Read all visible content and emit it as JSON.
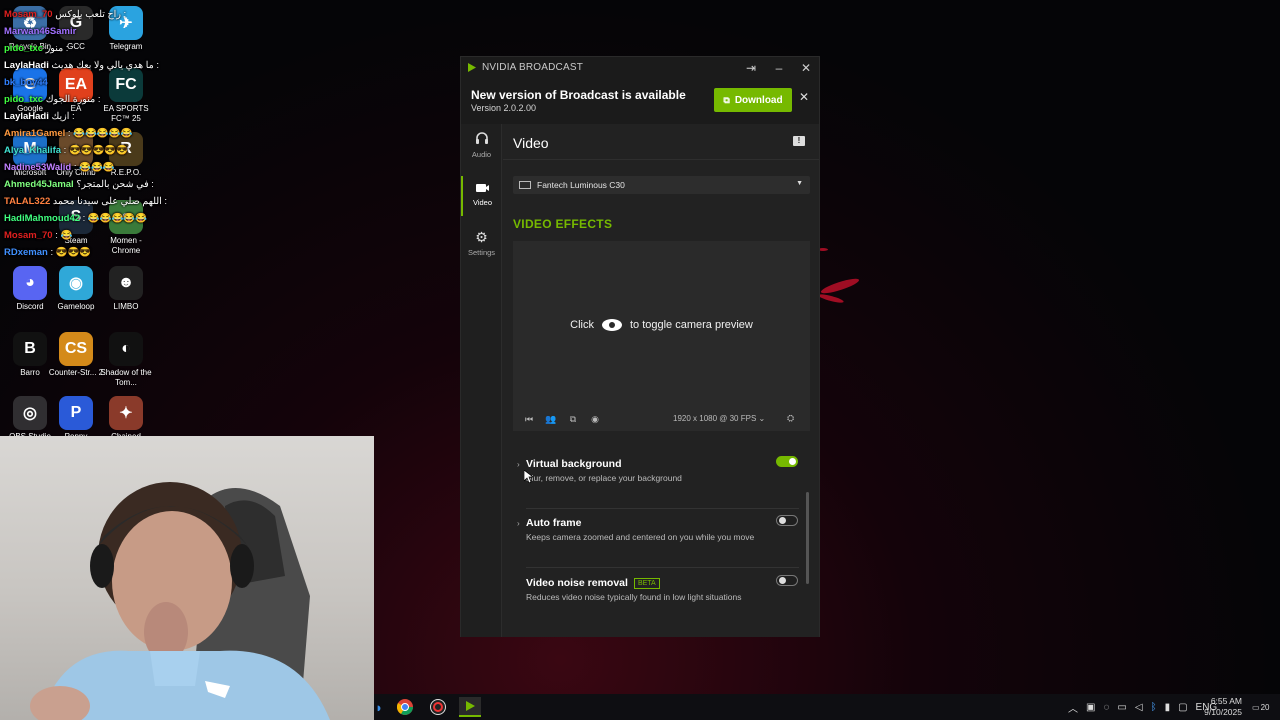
{
  "desktop": {
    "icons": [
      {
        "label": "Recycle Bin",
        "glyph": "♻",
        "color": "#3b6ea5"
      },
      {
        "label": "GCC",
        "glyph": "G",
        "color": "#2a2a2a"
      },
      {
        "label": "Telegram",
        "glyph": "✈",
        "color": "#2aa3e0"
      },
      {
        "label": "Google",
        "glyph": "G",
        "color": "#1a73e8"
      },
      {
        "label": "EA",
        "glyph": "EA",
        "color": "#e0401c"
      },
      {
        "label": "EA SPORTS FC™ 25",
        "glyph": "FC",
        "color": "#0b3a3a"
      },
      {
        "label": "Microsoft",
        "glyph": "M",
        "color": "#1c6fc9"
      },
      {
        "label": "Only Climb",
        "glyph": "▲",
        "color": "#6a4a2a"
      },
      {
        "label": "R.E.P.O.",
        "glyph": "R",
        "color": "#4a3a1a"
      },
      {
        "label": "Steam",
        "glyph": "S",
        "color": "#1b2838"
      },
      {
        "label": "Momen - Chrome",
        "glyph": "●",
        "color": "#3a7a3a"
      },
      {
        "label": "Discord",
        "glyph": "◕",
        "color": "#5865f2"
      },
      {
        "label": "Gameloop",
        "glyph": "◉",
        "color": "#2fa8d8"
      },
      {
        "label": "LIMBO",
        "glyph": "☻",
        "color": "#222222"
      },
      {
        "label": "Barro",
        "glyph": "B",
        "color": "#111111"
      },
      {
        "label": "Counter-Str... 2",
        "glyph": "CS",
        "color": "#d48a1a"
      },
      {
        "label": "Shadow of the Tom...",
        "glyph": "◐",
        "color": "#111111"
      },
      {
        "label": "OBS Studio",
        "glyph": "◎",
        "color": "#302e31"
      },
      {
        "label": "Poppy",
        "glyph": "P",
        "color": "#2a5ad8"
      },
      {
        "label": "Chained",
        "glyph": "✦",
        "color": "#8a3a2a"
      }
    ]
  },
  "chat": [
    {
      "user": "Mosam_70",
      "color": "#e02020",
      "msg": "راح تلعب بلوكس :"
    },
    {
      "user": "Marwan46Samir",
      "color": "#a070ff",
      "msg": ""
    },
    {
      "user": "pido_txc",
      "color": "#40ff40",
      "msg": "منور :"
    },
    {
      "user": "LaylaHadi",
      "color": "#ffffff",
      "msg": "ما هدي يالي ولا بعك هديث :"
    },
    {
      "user": "bk_boy44",
      "color": "#3080ff",
      "msg": ""
    },
    {
      "user": "pido_txc",
      "color": "#40ff40",
      "msg": "منورة الجوك :"
    },
    {
      "user": "LaylaHadi",
      "color": "#ffffff",
      "msg": "ازيك :"
    },
    {
      "user": "Amira1Gamel",
      "color": "#ff9a40",
      "msg": ": 😂😂😂😂😂"
    },
    {
      "user": "Alya_Khalifa",
      "color": "#40e0d0",
      "msg": ": 😎😎😎😎😎"
    },
    {
      "user": "Nadine53Walid",
      "color": "#c080ff",
      "msg": ": 😂😂😂"
    },
    {
      "user": "Ahmed45Jamal",
      "color": "#80ff80",
      "msg": "في شحن بالمتجر؟ :"
    },
    {
      "user": "TALAL322",
      "color": "#ff8040",
      "msg": "اللهم صلي على سيدنا محمد :"
    },
    {
      "user": "HadiMahmoud42",
      "color": "#40ff80",
      "msg": ": 😂😂😂😂😂"
    },
    {
      "user": "Mosam_70",
      "color": "#e02020",
      "msg": ": 😂"
    },
    {
      "user": "RDxeman",
      "color": "#4090ff",
      "msg": ": 😎😎😎"
    }
  ],
  "broadcast": {
    "window_title": "NVIDIA BROADCAST",
    "update": {
      "heading": "New version of Broadcast is available",
      "version": "Version 2.0.2.00",
      "download_label": "Download",
      "download_icon": "external-link-icon"
    },
    "nav": [
      {
        "label": "Audio",
        "icon": "headset-icon",
        "glyph": "🎧"
      },
      {
        "label": "Video",
        "icon": "camera-icon",
        "glyph": "▬"
      },
      {
        "label": "Settings",
        "icon": "gear-icon",
        "glyph": "⚙"
      }
    ],
    "page_title": "Video",
    "device": "Fantech Luminous C30",
    "effects_title": "VIDEO EFFECTS",
    "preview": {
      "click": "Click",
      "toggle_text": "to toggle camera preview",
      "resolution": "1920 x 1080 @ 30 FPS"
    },
    "effects": [
      {
        "name": "Virtual background",
        "desc": "Blur, remove, or replace your background",
        "enabled": true,
        "beta": ""
      },
      {
        "name": "Auto frame",
        "desc": "Keeps camera zoomed and centered on you while you move",
        "enabled": false,
        "beta": ""
      },
      {
        "name": "Video noise removal",
        "desc": "Reduces video noise typically found in low light situations",
        "enabled": false,
        "beta": "BETA"
      }
    ],
    "accent": "#76b900"
  },
  "taskbar": {
    "tray": {
      "lang": "ENG",
      "time": "6:55 AM",
      "date": "9/10/2025",
      "notifications": "20"
    }
  }
}
